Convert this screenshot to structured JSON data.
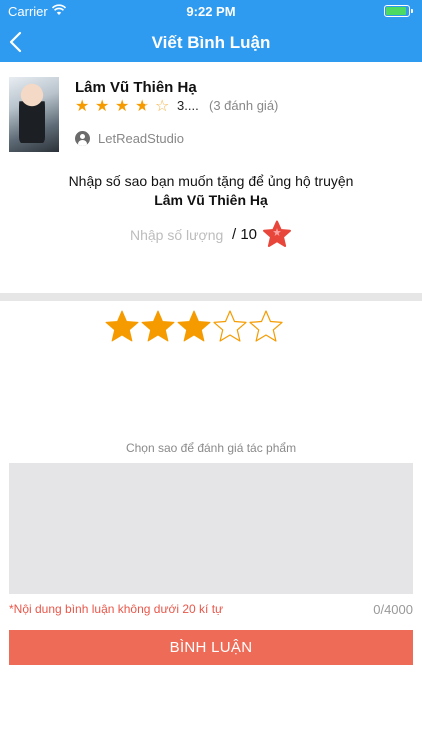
{
  "status_bar": {
    "carrier": "Carrier",
    "time": "9:22 PM"
  },
  "navbar": {
    "title": "Viết Bình Luận"
  },
  "book": {
    "title": "Lâm Vũ Thiên Hạ",
    "rating": 3.5,
    "rating_value_text": "3....",
    "rating_count": "(3 đánh giá)",
    "author": "LetReadStudio"
  },
  "gift": {
    "prompt": "Nhập số sao bạn muốn tặng để ủng hộ truyện",
    "book_title": "Lâm Vũ Thiên Hạ",
    "quantity_placeholder": "Nhập số lượng",
    "quantity_value": "",
    "quantity_max": "/ 10"
  },
  "review": {
    "selected_stars": 3,
    "total_stars": 5,
    "hint": "Chọn sao để đánh giá tác phẩm",
    "comment_value": "",
    "rule": "*Nội dung  bình luận không dưới 20 kí tự",
    "counter": "0/4000",
    "submit_label": "BÌNH LUẬN"
  },
  "colors": {
    "navbar": "#2f9bf0",
    "star": "#f59b00",
    "gift_star": "#e9463b",
    "submit": "#ee6b57",
    "rule_text": "#e8574a"
  },
  "icons": {
    "back": "chevron-left-icon",
    "author": "user-circle-icon",
    "gift_star": "star-icon",
    "wifi": "wifi-icon",
    "battery": "battery-icon"
  }
}
